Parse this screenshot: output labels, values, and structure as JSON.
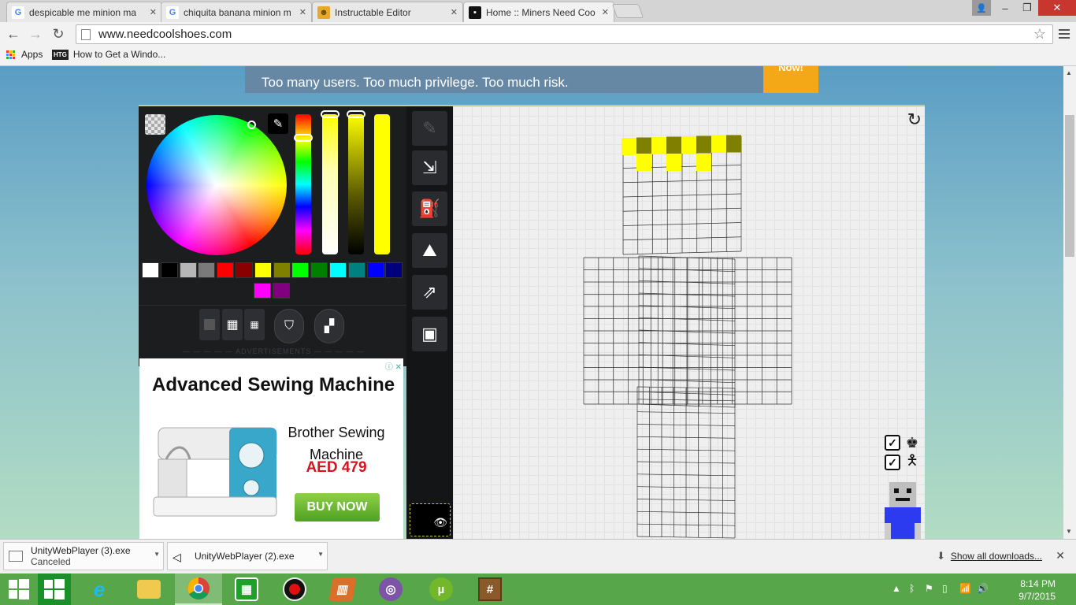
{
  "browser": {
    "tabs": [
      {
        "title": "despicable me minion ma",
        "icon": "google-icon",
        "active": false
      },
      {
        "title": "chiquita banana minion m",
        "icon": "google-icon",
        "active": false
      },
      {
        "title": "Instructable Editor",
        "icon": "instructables-icon",
        "active": false
      },
      {
        "title": "Home :: Miners Need Coo",
        "icon": "minecraft-face-icon",
        "active": true
      }
    ],
    "url": "www.needcoolshoes.com",
    "bookmarks": [
      {
        "label": "Apps",
        "icon": "apps-grid-icon"
      },
      {
        "label": "How to Get a Windo...",
        "icon": "htg-icon"
      }
    ],
    "htg_badge": "HTG"
  },
  "page": {
    "top_ad": {
      "text": "Too many users. Too much privilege. Too much risk.",
      "cta": "Now!"
    },
    "editor": {
      "palette_colors": [
        "#ffffff",
        "#000000",
        "#b7b7b7",
        "#7a7a7a",
        "#ff0000",
        "#8a0000",
        "#ffff00",
        "#7f7f00",
        "#00ff00",
        "#008000",
        "#00ffff",
        "#008080",
        "#0000ff",
        "#00007f",
        "#ff00ff",
        "#800080"
      ],
      "selected_color": "#ffff00",
      "advertisements_label": "ADVERTISEMENTS",
      "tools": [
        {
          "name": "brush-tool",
          "icon": "brush-icon",
          "enabled": false
        },
        {
          "name": "resize-tool",
          "icon": "resize-icon",
          "enabled": true
        },
        {
          "name": "fill-tool",
          "icon": "paint-bucket-icon",
          "enabled": true
        },
        {
          "name": "noise-tool",
          "icon": "area-chart-icon",
          "enabled": true
        },
        {
          "name": "share-tool",
          "icon": "share-icon",
          "enabled": true
        },
        {
          "name": "character-tool",
          "icon": "portrait-icon",
          "enabled": true
        }
      ]
    },
    "side_ad": {
      "title": "Advanced Sewing Machine",
      "product": "Brother Sewing Machine",
      "price": "AED 479",
      "cta": "BUY NOW"
    }
  },
  "downloads": {
    "items": [
      {
        "name": "UnityWebPlayer (3).exe",
        "status": "Canceled"
      },
      {
        "name": "UnityWebPlayer (2).exe",
        "status": ""
      }
    ],
    "show_all": "Show all downloads..."
  },
  "taskbar": {
    "apps": [
      "start",
      "windows-store-tile",
      "internet-explorer",
      "file-explorer",
      "chrome",
      "store",
      "recorder",
      "app-fire",
      "browser-ring",
      "utorrent",
      "minecraft"
    ],
    "clock": {
      "time": "8:14 PM",
      "date": "9/7/2015"
    }
  }
}
